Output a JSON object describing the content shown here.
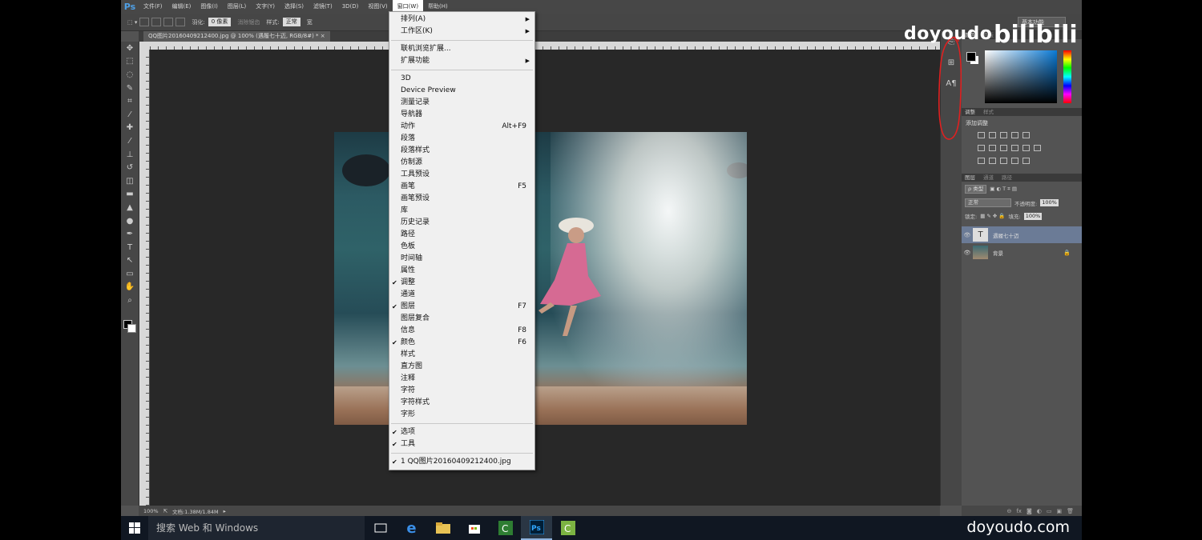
{
  "menubar": {
    "logo": "Ps",
    "items": [
      "文件(F)",
      "编辑(E)",
      "图像(I)",
      "图层(L)",
      "文字(Y)",
      "选择(S)",
      "滤镜(T)",
      "3D(D)",
      "视图(V)",
      "窗口(W)",
      "帮助(H)"
    ]
  },
  "options": {
    "feather_label": "羽化:",
    "feather_value": "0 像素",
    "antialias": "消除锯齿",
    "style_label": "样式:",
    "style_value": "正常",
    "width_label": "宽",
    "workspace": "基本功能"
  },
  "document": {
    "tab_title": "QQ图片20160409212400.jpg @ 100% (遇履七十迈, RGB/8#) *",
    "zoom": "100%",
    "doc_info": "文档:1.38M/1.84M"
  },
  "window_menu": {
    "groups": [
      [
        {
          "label": "排列(A)",
          "submenu": true
        },
        {
          "label": "工作区(K)",
          "submenu": true
        }
      ],
      [
        {
          "label": "联机浏览扩展..."
        },
        {
          "label": "扩展功能",
          "submenu": true
        }
      ],
      [
        {
          "label": "3D"
        },
        {
          "label": "Device Preview"
        },
        {
          "label": "测量记录"
        },
        {
          "label": "导航器"
        },
        {
          "label": "动作",
          "shortcut": "Alt+F9"
        },
        {
          "label": "段落"
        },
        {
          "label": "段落样式"
        },
        {
          "label": "仿制源"
        },
        {
          "label": "工具预设"
        },
        {
          "label": "画笔",
          "shortcut": "F5"
        },
        {
          "label": "画笔预设"
        },
        {
          "label": "库"
        },
        {
          "label": "历史记录"
        },
        {
          "label": "路径"
        },
        {
          "label": "色板"
        },
        {
          "label": "时间轴"
        },
        {
          "label": "属性"
        },
        {
          "label": "调整",
          "checked": true
        },
        {
          "label": "通道"
        },
        {
          "label": "图层",
          "checked": true,
          "shortcut": "F7"
        },
        {
          "label": "图层复合"
        },
        {
          "label": "信息",
          "shortcut": "F8"
        },
        {
          "label": "颜色",
          "checked": true,
          "shortcut": "F6"
        },
        {
          "label": "样式"
        },
        {
          "label": "直方图"
        },
        {
          "label": "注释"
        },
        {
          "label": "字符"
        },
        {
          "label": "字符样式"
        },
        {
          "label": "字形"
        }
      ],
      [
        {
          "label": "选项",
          "checked": true
        },
        {
          "label": "工具",
          "checked": true
        }
      ],
      [
        {
          "label": "1 QQ图片20160409212400.jpg",
          "checked": true
        }
      ]
    ]
  },
  "panels": {
    "color_tabs": [
      "颜色",
      "色板"
    ],
    "adjust_tabs": [
      "调整",
      "样式"
    ],
    "adjust_title": "添加调整",
    "layers_tabs": [
      "图层",
      "通道",
      "路径"
    ],
    "kind_filter": "ρ 类型",
    "blend_mode": "正常",
    "opacity_label": "不透明度:",
    "opacity_value": "100%",
    "lock_label": "锁定:",
    "fill_label": "填充:",
    "fill_value": "100%",
    "layers": [
      {
        "name": "遇履七十迈",
        "type": "text",
        "selected": true
      },
      {
        "name": "背景",
        "type": "image",
        "locked": true
      }
    ]
  },
  "watermark": {
    "brand": "doyoudo",
    "site_logo": "bilibili"
  },
  "taskbar": {
    "search_placeholder": "搜索 Web 和 Windows",
    "site": "doyoudo.com"
  },
  "colors": {
    "accent_red": "#e02020",
    "selection_blue": "#6b7b96",
    "ps_blue": "#4fa0e6"
  }
}
